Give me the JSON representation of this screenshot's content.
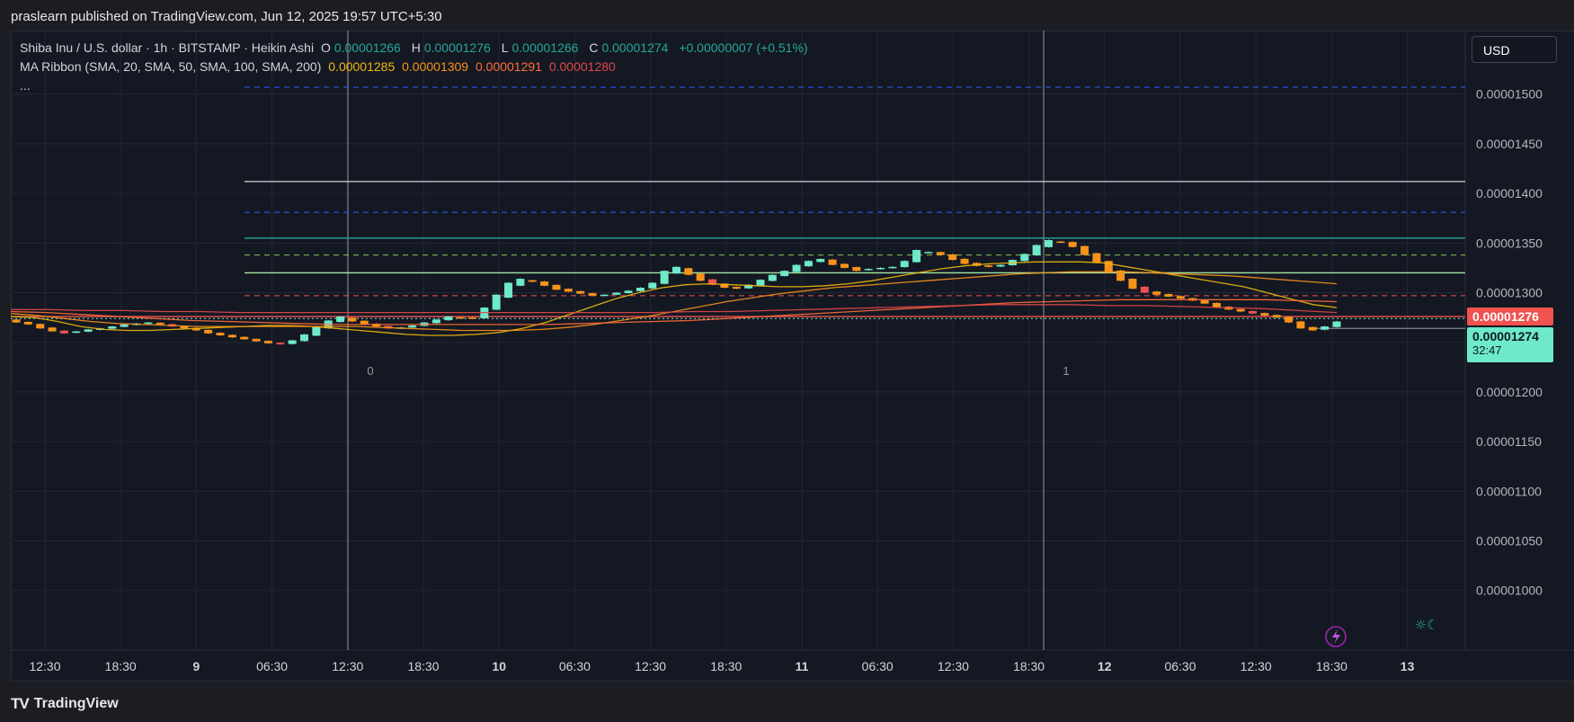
{
  "header": {
    "published": "praslearn published on TradingView.com, Jun 12, 2025 19:57 UTC+5:30"
  },
  "legend": {
    "symbol": "Shiba Inu / U.S. dollar · 1h · BITSTAMP · Heikin Ashi",
    "o_label": "O",
    "o_value": "0.00001266",
    "h_label": "H",
    "h_value": "0.00001276",
    "l_label": "L",
    "l_value": "0.00001266",
    "c_label": "C",
    "c_value": "0.00001274",
    "change": "+0.00000007 (+0.51%)",
    "ma_title": "MA Ribbon (SMA, 20, SMA, 50, SMA, 100, SMA, 200)",
    "ma_values": [
      "0.00001285",
      "0.00001309",
      "0.00001291",
      "0.00001280"
    ],
    "more": "..."
  },
  "toolbar": {
    "currency": "USD"
  },
  "price_tags": {
    "last_red": "0.00001276",
    "current": "0.00001274",
    "countdown": "32:47"
  },
  "footer": {
    "brand": "TradingView",
    "logo": "TV"
  },
  "colors": {
    "bull": "#6ee9c9",
    "bear": "#f7931a",
    "bear_red": "#ef5350",
    "ma20": "#f0b90b",
    "ma50": "#f7931a",
    "ma100": "#ff6d3a",
    "ma200": "#e04848",
    "grid": "#232735",
    "background": "#141823"
  },
  "icons": [
    "lightning-icon",
    "sun-moon-icon",
    "trading-view-logo"
  ],
  "chart_data": {
    "type": "candlestick",
    "y_axis": {
      "ticks": [
        "0.00001500",
        "0.00001450",
        "0.00001400",
        "0.00001350",
        "0.00001300",
        "0.00001250",
        "0.00001200",
        "0.00001150",
        "0.00001100",
        "0.00001050",
        "0.00001000"
      ],
      "ylim": [
        9.5e-06,
        1.58e-05
      ]
    },
    "x_axis": {
      "ticks": [
        "12:30",
        "18:30",
        "9",
        "06:30",
        "12:30",
        "18:30",
        "10",
        "06:30",
        "12:30",
        "18:30",
        "11",
        "06:30",
        "12:30",
        "18:30",
        "12",
        "06:30",
        "12:30",
        "18:30",
        "13"
      ]
    },
    "markers": [
      "0",
      "1"
    ],
    "levels": [
      {
        "price": 1.507e-05,
        "style": "dashed",
        "color": "#2962ff"
      },
      {
        "price": 1.412e-05,
        "style": "solid",
        "color": "#b2b5be"
      },
      {
        "price": 1.381e-05,
        "style": "dashed",
        "color": "#2962ff"
      },
      {
        "price": 1.355e-05,
        "style": "solid",
        "color": "#26a69a"
      },
      {
        "price": 1.338e-05,
        "style": "dashed",
        "color": "#8bc34a"
      },
      {
        "price": 1.32e-05,
        "style": "solid",
        "color": "#a5e6a0"
      },
      {
        "price": 1.297e-05,
        "style": "dashed",
        "color": "#ef5350"
      },
      {
        "price": 1.276e-05,
        "style": "solid",
        "color": "#ef5350"
      },
      {
        "price": 1.274e-05,
        "style": "dotted",
        "color": "#6ee9c9"
      },
      {
        "price": 1.264e-05,
        "style": "solid",
        "color": "#787b86"
      }
    ],
    "series": [
      {
        "kind": "candles",
        "close_path": [
          1270,
          1268,
          1264,
          1261,
          1259,
          1261,
          1263,
          1264,
          1266,
          1268,
          1269,
          1270,
          1268,
          1266,
          1264,
          1262,
          1259,
          1257,
          1255,
          1253,
          1251,
          1249,
          1248,
          1252,
          1258,
          1266,
          1272,
          1276,
          1271,
          1268,
          1266,
          1264,
          1265,
          1267,
          1270,
          1273,
          1276,
          1275,
          1274,
          1285,
          1298,
          1310,
          1314,
          1311,
          1307,
          1303,
          1301,
          1299,
          1297,
          1298,
          1300,
          1302,
          1305,
          1310,
          1322,
          1326,
          1318,
          1312,
          1308,
          1305,
          1304,
          1308,
          1313,
          1318,
          1322,
          1328,
          1332,
          1334,
          1328,
          1325,
          1322,
          1324,
          1325,
          1326,
          1332,
          1343,
          1341,
          1338,
          1333,
          1329,
          1327,
          1326,
          1328,
          1333,
          1339,
          1348,
          1353,
          1351,
          1346,
          1338,
          1330,
          1320,
          1312,
          1304,
          1300,
          1298,
          1296,
          1294,
          1292,
          1289,
          1285,
          1283,
          1281,
          1279,
          1277,
          1275,
          1270,
          1264,
          1262,
          1266,
          1271
        ]
      },
      {
        "kind": "ma",
        "name": "SMA 20",
        "values": [
          1276,
          1275,
          1271,
          1266,
          1263,
          1262,
          1262,
          1263,
          1264,
          1265,
          1266,
          1267,
          1267,
          1266,
          1264,
          1262,
          1260,
          1258,
          1257,
          1257,
          1258,
          1260,
          1264,
          1270,
          1278,
          1286,
          1294,
          1300,
          1305,
          1308,
          1309,
          1308,
          1307,
          1306,
          1306,
          1307,
          1309,
          1312,
          1316,
          1320,
          1324,
          1327,
          1329,
          1330,
          1331,
          1331,
          1331,
          1330,
          1326,
          1322,
          1318,
          1314,
          1310,
          1306,
          1300,
          1294,
          1288,
          1285
        ]
      },
      {
        "kind": "ma",
        "name": "SMA 50",
        "values": [
          1279,
          1277,
          1274,
          1271,
          1269,
          1268,
          1267,
          1266,
          1266,
          1266,
          1266,
          1266,
          1266,
          1266,
          1265,
          1264,
          1263,
          1262,
          1262,
          1262,
          1263,
          1265,
          1268,
          1272,
          1276,
          1281,
          1286,
          1291,
          1295,
          1299,
          1302,
          1305,
          1307,
          1309,
          1311,
          1313,
          1315,
          1317,
          1319,
          1320,
          1321,
          1321,
          1321,
          1320,
          1319,
          1318,
          1317,
          1315,
          1313,
          1311,
          1309
        ]
      },
      {
        "kind": "ma",
        "name": "SMA 100",
        "values": [
          1281,
          1280,
          1278,
          1276,
          1274,
          1272,
          1271,
          1270,
          1269,
          1268,
          1268,
          1268,
          1268,
          1268,
          1268,
          1268,
          1269,
          1270,
          1271,
          1272,
          1274,
          1276,
          1278,
          1280,
          1282,
          1284,
          1286,
          1288,
          1290,
          1291,
          1292,
          1293,
          1293,
          1293,
          1293,
          1293,
          1292,
          1291
        ]
      },
      {
        "kind": "ma",
        "name": "SMA 200",
        "values": [
          1283,
          1283,
          1282,
          1282,
          1281,
          1281,
          1280,
          1280,
          1280,
          1280,
          1280,
          1280,
          1280,
          1280,
          1280,
          1280,
          1280,
          1280,
          1281,
          1281,
          1282,
          1283,
          1284,
          1285,
          1286,
          1287,
          1288,
          1288,
          1288,
          1287,
          1287,
          1286,
          1285,
          1284,
          1282,
          1280
        ]
      }
    ]
  }
}
